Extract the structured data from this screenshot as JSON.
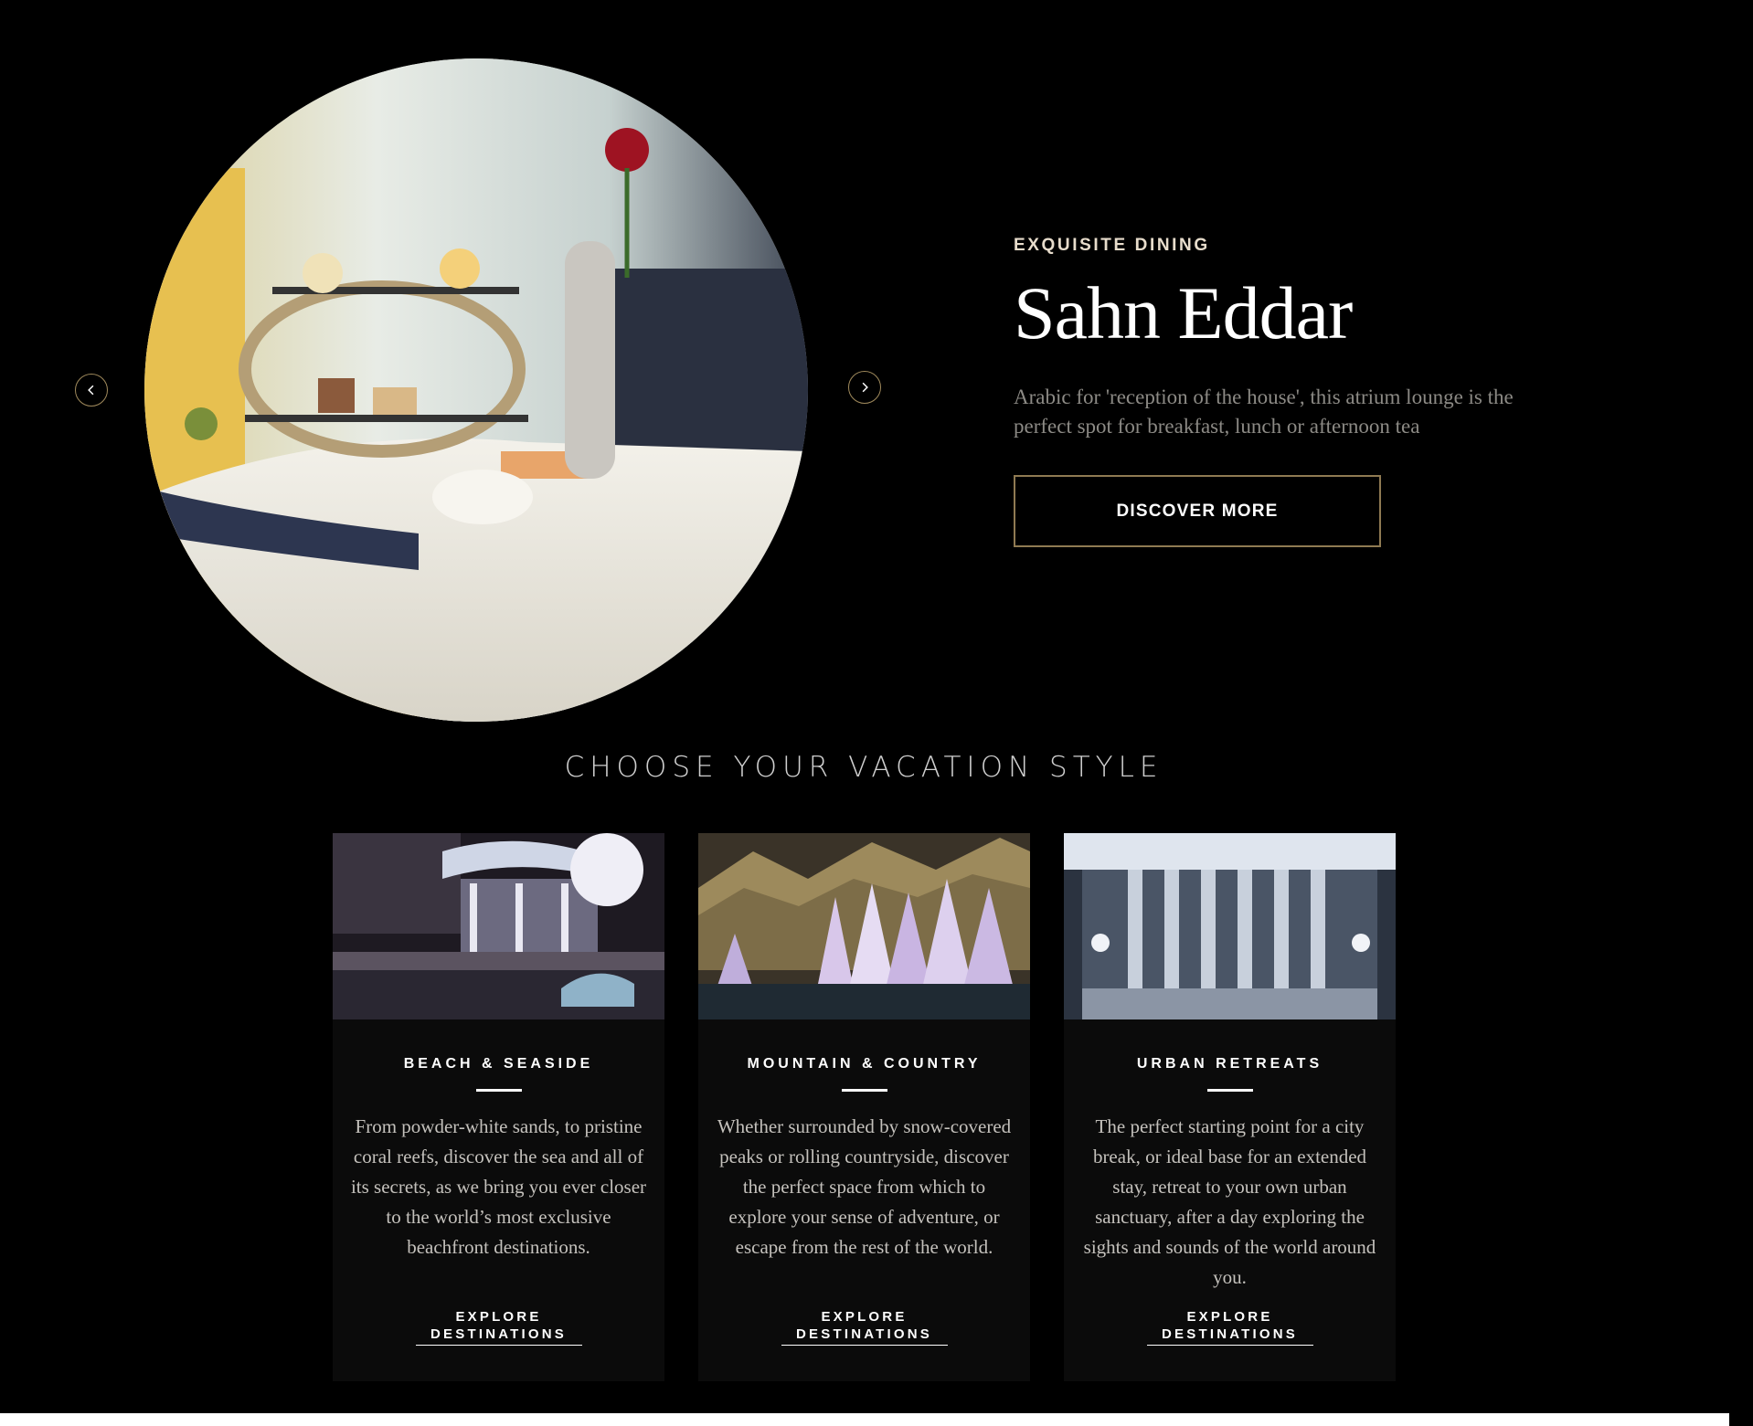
{
  "hero": {
    "eyebrow": "EXQUISITE DINING",
    "title": "Sahn Eddar",
    "description": "Arabic for 'reception of the house', this atrium lounge is the perfect spot for breakfast, lunch or afternoon tea",
    "button_label": "DISCOVER MORE",
    "prev_icon": "chevron-left-icon",
    "next_icon": "chevron-right-icon"
  },
  "vacation": {
    "section_title": "CHOOSE YOUR VACATION STYLE",
    "cards": [
      {
        "title": "BEACH & SEASIDE",
        "text": "From powder-white sands, to pristine coral reefs, discover the sea and all of its secrets, as we bring you ever closer to the world’s most exclusive beachfront destinations.",
        "link_line1": "EXPLORE",
        "link_line2": "DESTINATIONS"
      },
      {
        "title": "MOUNTAIN & COUNTRY",
        "text": "Whether surrounded by snow-covered peaks or rolling countryside, discover the perfect space from which to explore your sense of adventure, or escape from the rest of the world.",
        "link_line1": "EXPLORE",
        "link_line2": "DESTINATIONS"
      },
      {
        "title": "URBAN RETREATS",
        "text": "The perfect starting point for a city break, or ideal base for an extended stay, retreat to your own urban sanctuary, after a day exploring the sights and sounds of the world around you.",
        "link_line1": "EXPLORE",
        "link_line2": "DESTINATIONS"
      }
    ]
  },
  "colors": {
    "background": "#000000",
    "accent_gold": "#8f7a52",
    "card_background": "#0b0b0b",
    "muted_text": "#8c8a85"
  }
}
